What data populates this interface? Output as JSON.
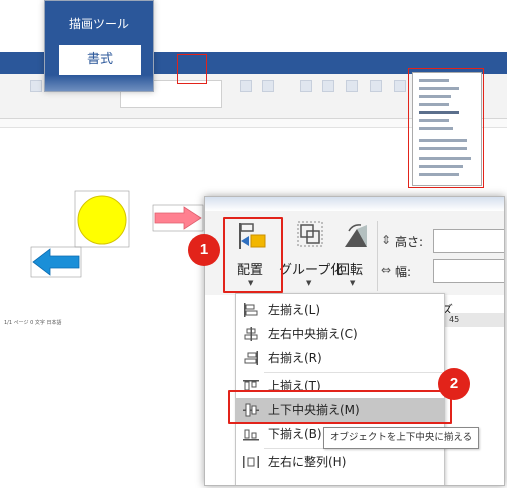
{
  "context_tab": {
    "group_label": "描画ツール",
    "format_tab": "書式"
  },
  "background_window": {
    "status_text": "1/1 ページ  0 文字  日本語"
  },
  "toolbar": {
    "arrange_label": "配置",
    "group_label": "グループ化",
    "rotate_label": "回転",
    "height_label": "高さ:",
    "width_label": "幅:",
    "size_group_fragment": "ズ",
    "ruler_value": "45"
  },
  "align_menu": {
    "items": [
      {
        "label": "左揃え(L)",
        "icon": "align-left-icon"
      },
      {
        "label": "左右中央揃え(C)",
        "icon": "align-center-icon"
      },
      {
        "label": "右揃え(R)",
        "icon": "align-right-icon"
      },
      {
        "label": "上揃え(T)",
        "icon": "align-top-icon"
      },
      {
        "label": "上下中央揃え(M)",
        "icon": "align-middle-icon"
      },
      {
        "label": "下揃え(B)",
        "icon": "align-bottom-icon"
      },
      {
        "label": "左右に整列(H)",
        "icon": "distribute-horizontal-icon"
      }
    ],
    "highlighted_index": 4
  },
  "tooltip": {
    "text": "オブジェクトを上下中央に揃える"
  },
  "steps": [
    "1",
    "2"
  ],
  "colors": {
    "ribbon_blue": "#2b579a",
    "highlight_red": "#e2231a",
    "circle_yellow": "#ffff00",
    "arrow_pink": "#ff8090",
    "arrow_blue": "#1a8fd8"
  }
}
